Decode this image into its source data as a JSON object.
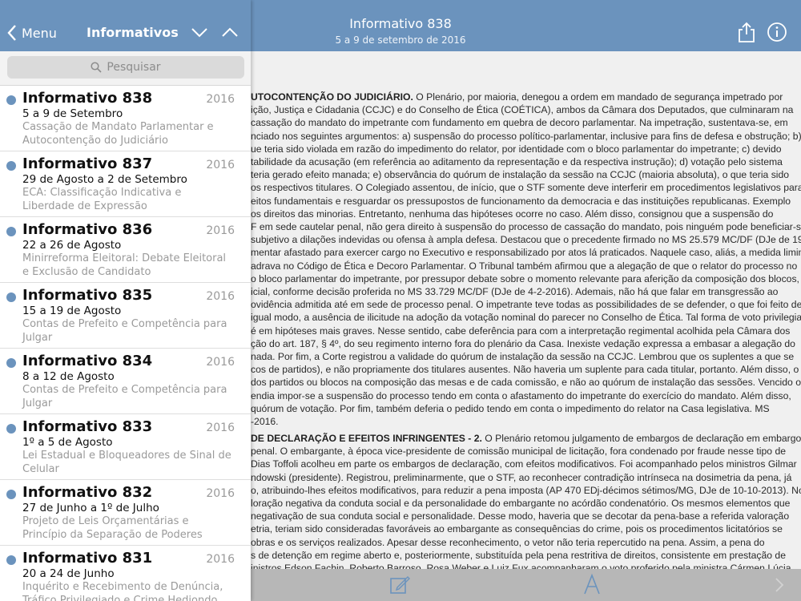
{
  "header": {
    "title": "Informativo 838",
    "subtitle": "5 a 9 de setembro de 2016"
  },
  "sidebar": {
    "menu_label": "Menu",
    "title": "Informativos",
    "search_placeholder": "Pesquisar",
    "items": [
      {
        "title": "Informativo 838",
        "year": "2016",
        "date": "5 a 9 de Setembro",
        "summary": "Cassação de Mandato Parlamentar e Autocontenção do Judiciário"
      },
      {
        "title": "Informativo 837",
        "year": "2016",
        "date": "29 de Agosto a 2 de Setembro",
        "summary": "ECA: Classificação Indicativa e Liberdade de Expressão"
      },
      {
        "title": "Informativo 836",
        "year": "2016",
        "date": "22 a 26 de Agosto",
        "summary": "Minirreforma Eleitoral: Debate Eleitoral e Exclusão de Candidato"
      },
      {
        "title": "Informativo 835",
        "year": "2016",
        "date": "15 a 19 de Agosto",
        "summary": "Contas de Prefeito e Competência para Julgar"
      },
      {
        "title": "Informativo 834",
        "year": "2016",
        "date": "8 a 12 de Agosto",
        "summary": "Contas de Prefeito e Competência para Julgar"
      },
      {
        "title": "Informativo 833",
        "year": "2016",
        "date": "1º a 5 de Agosto",
        "summary": "Lei Estadual e Bloqueadores de Sinal de Celular"
      },
      {
        "title": "Informativo 832",
        "year": "2016",
        "date": "27 de Junho a 1º de Julho",
        "summary": "Projeto de Leis Orçamentárias e Princípio da Separação de Poderes"
      },
      {
        "title": "Informativo 831",
        "year": "2016",
        "date": "20 a 24 de Junho",
        "summary": "Inquérito e Recebimento de Denúncia, Tráfico Privilegiado e Crime Hediondo"
      }
    ]
  },
  "document": {
    "para1_heading": "UTOCONTENÇÃO DO JUDICIÁRIO.",
    "para1_lines": [
      " O Plenário, por maioria, denegou a ordem em mandado de segurança impetrado por",
      "ição, Justiça e Cidadania (CCJC) e do Conselho de Ética (COÉTICA), ambos da Câmara dos Deputados, que culminaram na",
      "cassação do mandato do impetrante com fundamento em quebra de decoro parlamentar. Na impetração, sustentava-se, em",
      "nciado nos seguintes argumentos: a) suspensão do processo político-parlamentar, inclusive para fins de defesa e obstrução; b)",
      "ue teria sido violada em razão do impedimento do relator, por identidade com o bloco parlamentar do impetrante; c) devido",
      "tabilidade da acusação (em referência ao aditamento da representação e da respectiva instrução); d) votação pelo sistema",
      " teria gerado efeito manada; e) observância do quórum de instalação da sessão na CCJC (maioria absoluta), o que teria sido",
      "os respectivos titulares. O Colegiado assentou, de início, que o STF somente deve interferir em procedimentos legislativos para",
      "eitos fundamentais e resguardar os pressupostos de funcionamento da democracia e das instituições republicanas. Exemplo",
      "os direitos das minorias. Entretanto, nenhuma das hipóteses ocorre no caso. Além disso, consignou que a suspensão do",
      "F em sede cautelar penal, não gera direito à suspensão do processo de cassação do mandato, pois ninguém pode beneficiar-se",
      "subjetivo a dilações indevidas ou ofensa à ampla defesa. Destacou que o precedente firmado no MS 25.579 MC/DF (DJe de 19-",
      "mentar afastado para exercer cargo no Executivo e responsabilizado por atos lá praticados. Naquele caso, aliás, a medida liminar",
      "adrava no Código de Ética e Decoro Parlamentar. O Tribunal também afirmou que a alegação de que o relator do processo no",
      "o bloco parlamentar do impetrante, por pressupor debate sobre o momento relevante para aferição da composição dos blocos,",
      "icial, conforme decisão proferida no MS 33.729 MC/DF (DJe de 4-2-2016). Ademais, não há que falar em transgressão ao",
      "ovidência admitida até em sede de processo penal. O impetrante teve todas as possibilidades de se defender, o que foi feito de",
      "igual modo, a ausência de ilicitude na adoção da votação nominal do parecer no Conselho de Ética. Tal forma de voto privilegia",
      "é em hipóteses mais graves. Nesse sentido, cabe deferência para com a interpretação regimental acolhida pela Câmara dos",
      "ção do art. 187, § 4º, do seu regimento interno fora do plenário da Casa. Inexiste vedação expressa a embasar a alegação do",
      "nada. Por fim, a Corte registrou a validade do quórum de instalação da sessão na CCJC. Lembrou que os suplentes a que se",
      "cos de partidos), e não propriamente dos titulares ausentes. Não haveria um suplente para cada titular, portanto. Além disso, o",
      "dos partidos ou blocos na composição das mesas e de cada comissão, e não ao quórum de instalação das sessões. Vencido o",
      "endia impor-se a suspensão do processo tendo em conta o afastamento do impetrante do exercício do mandato. Além disso,",
      " quórum de votação. Por fim, também deferia o pedido tendo em conta o impedimento do relator na Casa legislativa. MS",
      "-2016."
    ],
    "para2_heading": "DE DECLARAÇÃO E EFEITOS INFRINGENTES - 2.",
    "para2_lines": [
      " O Plenário retomou julgamento de embargos de declaração em embargos",
      " penal. O embargante, à época vice-presidente de comissão municipal de licitação, fora condenado por fraude nesse tipo de",
      "Dias Toffoli acolheu em parte os embargos de declaração, com efeitos modificativos. Foi acompanhado pelos ministros Gilmar",
      "ndowski (presidente). Registrou, preliminarmente, que o STF, ao reconhecer contradição intrínseca na dosimetria da pena, já",
      "o, atribuindo-lhes efeitos modificativos, para reduzir a pena imposta (AP 470 EDj-décimos sétimos/MG, DJe de 10-10-2013). No",
      "loração negativa da conduta social e da personalidade do embargante no acórdão condenatório. Os mesmos elementos que",
      " negativação de sua conduta social e personalidade. Desse modo, haveria que se decotar da pena-base a referida valoração",
      "etria, teriam sido consideradas favoráveis ao embargante as consequências do crime, pois os procedimentos licitatórios se",
      " obras e os serviços realizados. Apesar desse reconhecimento, o vetor não teria repercutido na pena. Assim, a pena do",
      "s de detenção em regime aberto e, posteriormente, substituída pela pena restritiva de direitos, consistente em prestação de",
      "inistros Edson Fachin, Roberto Barroso, Rosa Weber e Luiz Fux acompanharam o voto proferido pela ministra Cármen Lúcia"
    ]
  },
  "icons": {
    "back": "chevron-left-icon",
    "down": "chevron-down-icon",
    "up": "chevron-up-icon",
    "search": "search-icon",
    "share": "share-icon",
    "info": "info-icon",
    "annotate": "compose-icon",
    "font": "font-icon",
    "next": "chevron-right-icon"
  },
  "colors": {
    "accent": "#6b93bd",
    "unread_dot": "#6b93bd"
  }
}
